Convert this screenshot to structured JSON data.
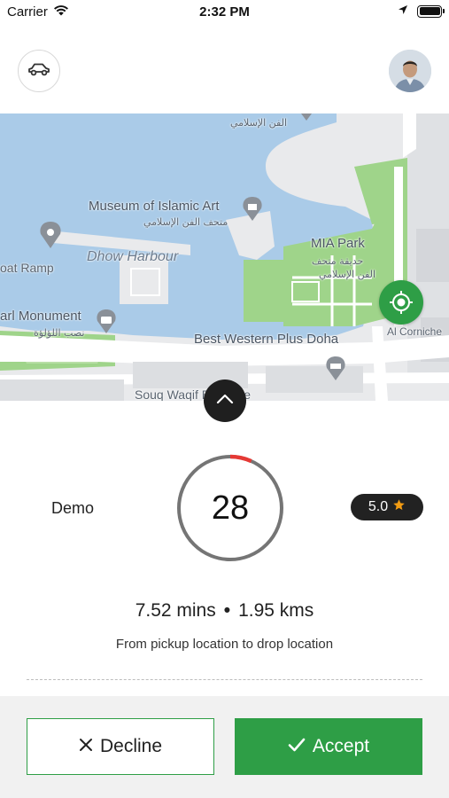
{
  "status_bar": {
    "carrier": "Carrier",
    "time": "2:32 PM"
  },
  "header": {
    "car_icon": "car-icon",
    "avatar_icon": "user-avatar"
  },
  "map": {
    "labels": {
      "arabic_top": "الفن الإسلامي",
      "museum": "Museum of Islamic Art",
      "museum_ar": "متحف الفن الإسلامي",
      "dhow_harbour": "Dhow Harbour",
      "boat_ramp": "oat Ramp",
      "mia_park": "MIA Park",
      "mia_park_ar1": "حديقة متحف",
      "mia_park_ar2": "الفن الإسلامي",
      "pearl_monument": "arl Monument",
      "pearl_monument_ar": "نصب اللؤلؤة",
      "best_western": "Best Western Plus Doha",
      "al_corniche": "Al Corniche",
      "souq": "Souq Waqif Boutique"
    },
    "colors": {
      "water": "#aacbe8",
      "park": "#9fd48a",
      "land": "#e9eaec",
      "road": "#ffffff"
    }
  },
  "request": {
    "rider_name": "Demo",
    "countdown": "28",
    "countdown_total": 30,
    "countdown_progress": 0.933,
    "rating": "5.0",
    "duration": "7.52 mins",
    "separator": "•",
    "distance": "1.95 kms",
    "description": "From pickup location to drop location"
  },
  "actions": {
    "decline_label": "Decline",
    "accept_label": "Accept"
  },
  "colors": {
    "accent": "#2e9e46",
    "timer_warning": "#e53935",
    "rating_star": "#f39c12",
    "dark": "#1f1f1f"
  }
}
